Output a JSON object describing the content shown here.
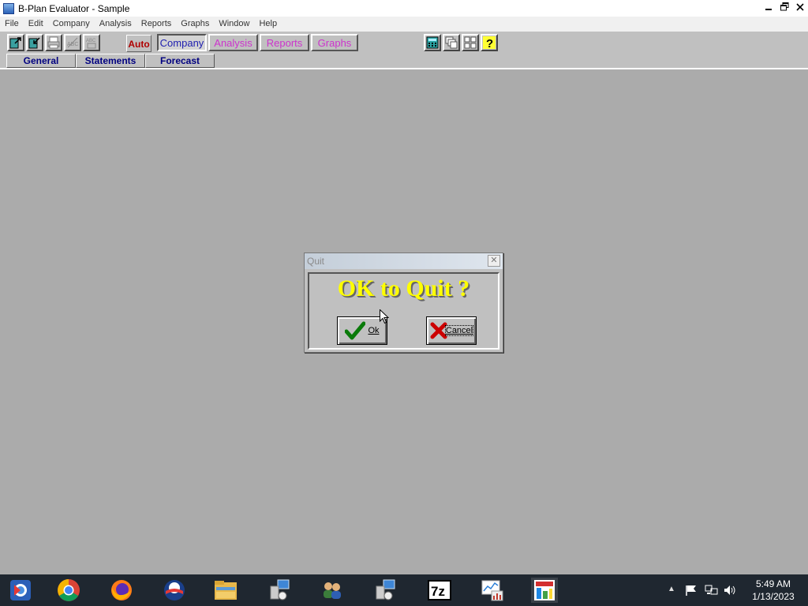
{
  "window": {
    "title": "B-Plan Evaluator - Sample"
  },
  "menu": [
    "File",
    "Edit",
    "Company",
    "Analysis",
    "Reports",
    "Graphs",
    "Window",
    "Help"
  ],
  "toolbar": {
    "auto_label": "Auto",
    "module_tabs": [
      "Company",
      "Analysis",
      "Reports",
      "Graphs"
    ],
    "active_module": "Company",
    "sub_tabs": [
      "General",
      "Statements",
      "Forecast"
    ]
  },
  "dialog": {
    "title": "Quit",
    "close_glyph": "✕",
    "prompt": "OK to Quit ?",
    "ok_label": "Ok",
    "cancel_label": "Cancel"
  },
  "taskbar": {
    "apps": [
      "start-orb-icon",
      "chrome-icon",
      "firefox-icon",
      "opera-icon",
      "file-explorer-icon",
      "network-setup-icon",
      "people-icon",
      "network-setup-icon",
      "7zip-icon",
      "task-manager-icon",
      "bplan-evaluator-icon"
    ],
    "time": "5:49 AM",
    "date": "1/13/2023"
  },
  "colors": {
    "workspace": "#ababab",
    "dialog_prompt": "#ffff00",
    "module_inactive": "#cc33cc",
    "module_active": "#2020b0",
    "auto_label": "#b00000",
    "taskbar": "#1f2730"
  }
}
